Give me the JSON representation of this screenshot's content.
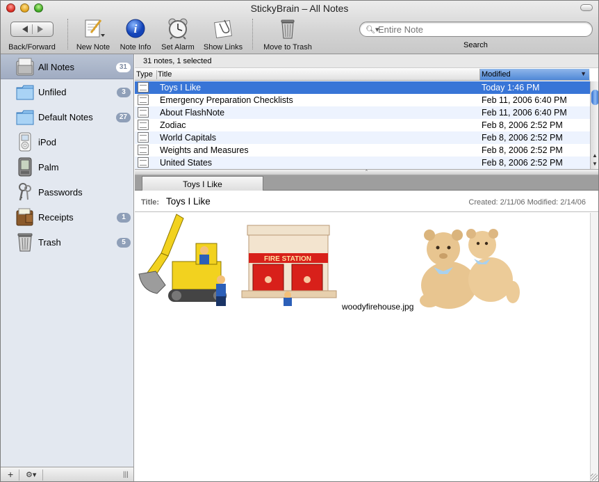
{
  "window": {
    "title": "StickyBrain – All Notes"
  },
  "toolbar": {
    "back_forward": "Back/Forward",
    "new_note": "New Note",
    "note_info": "Note Info",
    "set_alarm": "Set Alarm",
    "show_links": "Show Links",
    "move_to_trash": "Move to Trash",
    "search_placeholder": "Entire Note",
    "search_label": "Search"
  },
  "sidebar": {
    "items": [
      {
        "label": "All Notes",
        "count": "31",
        "icon": "all-notes-icon"
      },
      {
        "label": "Unfiled",
        "count": "3",
        "icon": "folder-icon"
      },
      {
        "label": "Default Notes",
        "count": "27",
        "icon": "folder-icon"
      },
      {
        "label": "iPod",
        "count": "",
        "icon": "ipod-icon"
      },
      {
        "label": "Palm",
        "count": "",
        "icon": "palm-icon"
      },
      {
        "label": "Passwords",
        "count": "",
        "icon": "keys-icon"
      },
      {
        "label": "Receipts",
        "count": "1",
        "icon": "wallet-icon"
      },
      {
        "label": "Trash",
        "count": "5",
        "icon": "trash-icon"
      }
    ],
    "footer": {
      "add": "+",
      "action": "⚙▾",
      "grip": "|||"
    }
  },
  "list": {
    "status": "31 notes, 1 selected",
    "columns": {
      "type": "Type",
      "title": "Title",
      "modified": "Modified"
    },
    "rows": [
      {
        "title": "Toys I Like",
        "modified": "Today 1:46 PM"
      },
      {
        "title": "Emergency Preparation Checklists",
        "modified": "Feb 11, 2006 6:40 PM"
      },
      {
        "title": "About FlashNote",
        "modified": "Feb 11, 2006 6:40 PM"
      },
      {
        "title": "Zodiac",
        "modified": "Feb 8, 2006 2:52 PM"
      },
      {
        "title": "World Capitals",
        "modified": "Feb 8, 2006 2:52 PM"
      },
      {
        "title": "Weights and Measures",
        "modified": "Feb 8, 2006 2:52 PM"
      },
      {
        "title": "United States",
        "modified": "Feb 8, 2006 2:52 PM"
      }
    ]
  },
  "note": {
    "tab": "Toys I Like",
    "title_label": "Title:",
    "title": "Toys I Like",
    "dates": "Created: 2/11/06  Modified: 2/14/06",
    "image_caption": "woodyfirehouse.jpg",
    "firehouse_sign": "FIRE STATION"
  },
  "colors": {
    "selection": "#3875d7",
    "sidebar_bg": "#e3e8f0",
    "badge": "#8f9fb8"
  }
}
